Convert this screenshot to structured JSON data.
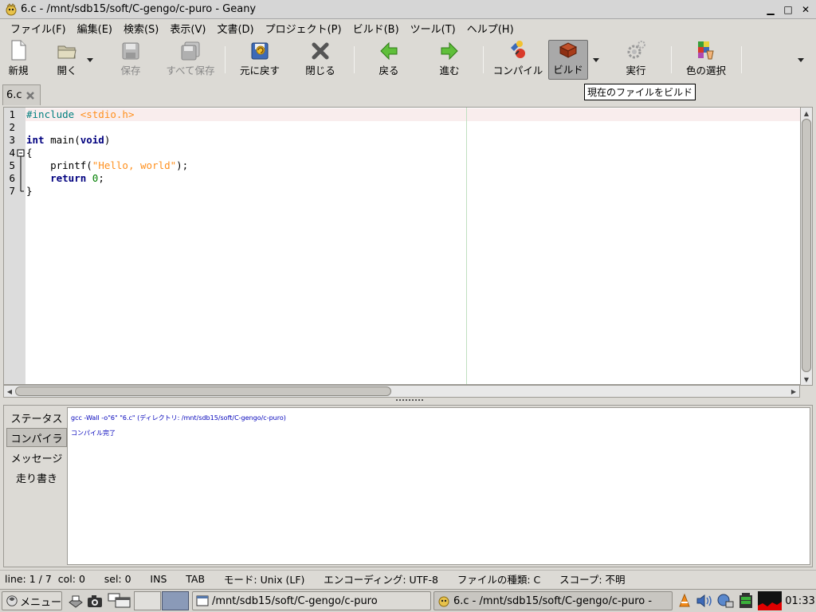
{
  "window": {
    "title": "6.c - /mnt/sdb15/soft/C-gengo/c-puro - Geany"
  },
  "menu": [
    "ファイル(F)",
    "編集(E)",
    "検索(S)",
    "表示(V)",
    "文書(D)",
    "プロジェクト(P)",
    "ビルド(B)",
    "ツール(T)",
    "ヘルプ(H)"
  ],
  "toolbar": {
    "new": "新規",
    "open": "開く",
    "save": "保存",
    "save_all": "すべて保存",
    "revert": "元に戻す",
    "close": "閉じる",
    "back": "戻る",
    "forward": "進む",
    "compile": "コンパイル",
    "build": "ビルド",
    "run": "実行",
    "color": "色の選択"
  },
  "tooltip": "現在のファイルをビルド",
  "tab": {
    "label": "6.c"
  },
  "editor": {
    "line_numbers": [
      "1",
      "2",
      "3",
      "4",
      "5",
      "6",
      "7"
    ],
    "lines": [
      [
        {
          "t": "#include ",
          "c": "pp"
        },
        {
          "t": "<stdio.h>",
          "c": "str"
        }
      ],
      [],
      [
        {
          "t": "int",
          "c": "kw"
        },
        {
          "t": " main(",
          "c": ""
        },
        {
          "t": "void",
          "c": "kw"
        },
        {
          "t": ")",
          "c": ""
        }
      ],
      [
        {
          "t": "{",
          "c": ""
        }
      ],
      [
        {
          "t": "    printf(",
          "c": ""
        },
        {
          "t": "\"Hello, world\"",
          "c": "str"
        },
        {
          "t": ");",
          "c": ""
        }
      ],
      [
        {
          "t": "    ",
          "c": ""
        },
        {
          "t": "return",
          "c": "kw"
        },
        {
          "t": " ",
          "c": ""
        },
        {
          "t": "0",
          "c": "num"
        },
        {
          "t": ";",
          "c": ""
        }
      ],
      [
        {
          "t": "}",
          "c": ""
        }
      ]
    ]
  },
  "message_tabs": {
    "status": "ステータス",
    "compiler": "コンパイラ",
    "messages": "メッセージ",
    "scribble": "走り書き"
  },
  "compiler_output": {
    "line1": "gcc -Wall -o\"6\" \"6.c\" (ディレクトリ: /mnt/sdb15/soft/C-gengo/c-puro)",
    "line2": "コンパイル完了"
  },
  "status": {
    "line": "line: 1 / 7",
    "col": "col: 0",
    "sel": "sel: 0",
    "ins": "INS",
    "tab": "TAB",
    "mode": "モード: Unix (LF)",
    "encoding": "エンコーディング: UTF-8",
    "filetype": "ファイルの種類: C",
    "scope": "スコープ: 不明"
  },
  "taskbar": {
    "menu": "メニュー",
    "task1": "/mnt/sdb15/soft/C-gengo/c-puro",
    "task2": "6.c - /mnt/sdb15/soft/C-gengo/c-puro -",
    "clock": "01:33"
  },
  "icons": {
    "new": "new-document-icon",
    "open": "open-folder-icon",
    "save": "save-disk-icon",
    "build": "build-bricks-icon",
    "run": "run-gear-icon",
    "color": "color-palette-icon"
  },
  "colors": {
    "keyword": "#00007f",
    "string": "#ff901e",
    "preprocessor": "#007f7f",
    "number": "#007f00",
    "compiler_text": "#0000bb"
  }
}
